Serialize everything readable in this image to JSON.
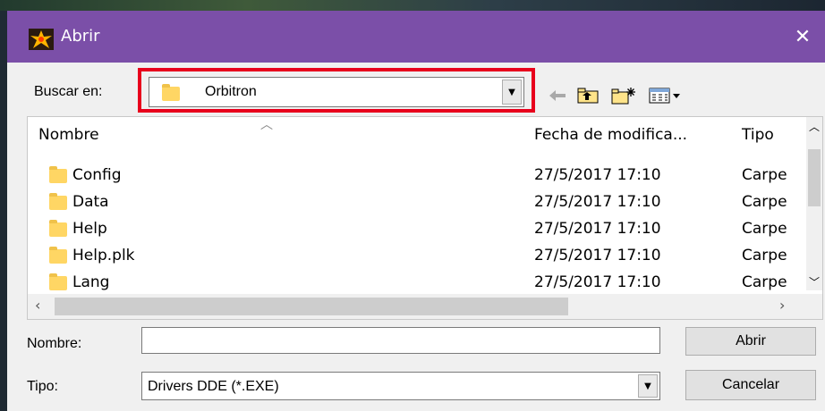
{
  "window": {
    "title": "Abrir",
    "accent_color": "#7b4fa8"
  },
  "look_in": {
    "label": "Buscar en:",
    "value": "Orbitron"
  },
  "toolbar": {
    "back_icon": "back-arrow-icon",
    "up_icon": "up-folder-icon",
    "new_folder_icon": "new-folder-icon",
    "view_icon": "view-menu-icon"
  },
  "columns": {
    "name": "Nombre",
    "date": "Fecha de modifica...",
    "type": "Tipo"
  },
  "files": [
    {
      "name": "Config",
      "date": "27/5/2017 17:10",
      "type": "Carpe"
    },
    {
      "name": "Data",
      "date": "27/5/2017 17:10",
      "type": "Carpe"
    },
    {
      "name": "Help",
      "date": "27/5/2017 17:10",
      "type": "Carpe"
    },
    {
      "name": "Help.plk",
      "date": "27/5/2017 17:10",
      "type": "Carpe"
    },
    {
      "name": "Lang",
      "date": "27/5/2017 17:10",
      "type": "Carpe"
    }
  ],
  "filename": {
    "label": "Nombre:",
    "value": ""
  },
  "filetype": {
    "label": "Tipo:",
    "value": "Drivers DDE (*.EXE)"
  },
  "buttons": {
    "open": "Abrir",
    "cancel": "Cancelar"
  }
}
